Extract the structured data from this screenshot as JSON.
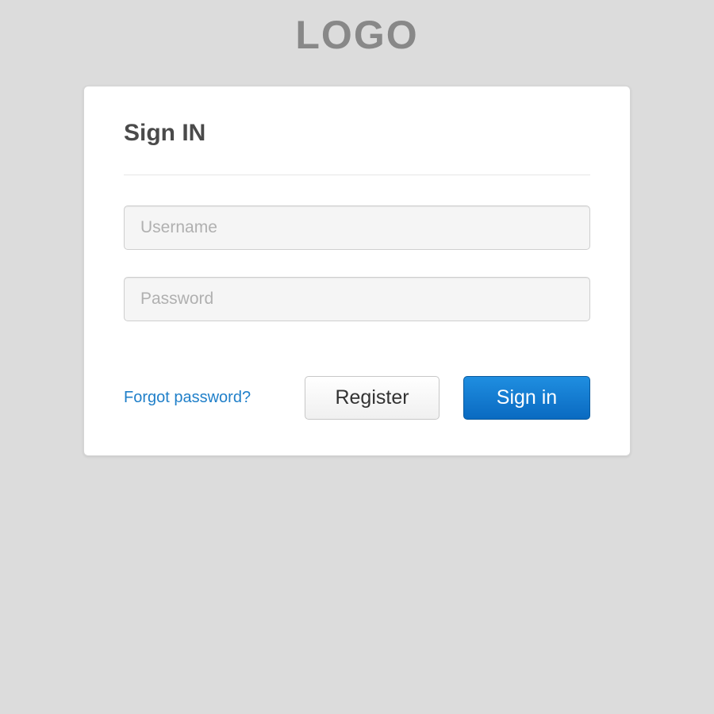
{
  "logo": "LOGO",
  "card": {
    "title": "Sign IN",
    "username": {
      "placeholder": "Username",
      "value": ""
    },
    "password": {
      "placeholder": "Password",
      "value": ""
    },
    "forgot_label": "Forgot password?",
    "register_label": "Register",
    "signin_label": "Sign in"
  },
  "colors": {
    "page_bg": "#dcdcdc",
    "link": "#1f7fc9",
    "primary_start": "#1f8ee0",
    "primary_end": "#0a6ac1"
  }
}
